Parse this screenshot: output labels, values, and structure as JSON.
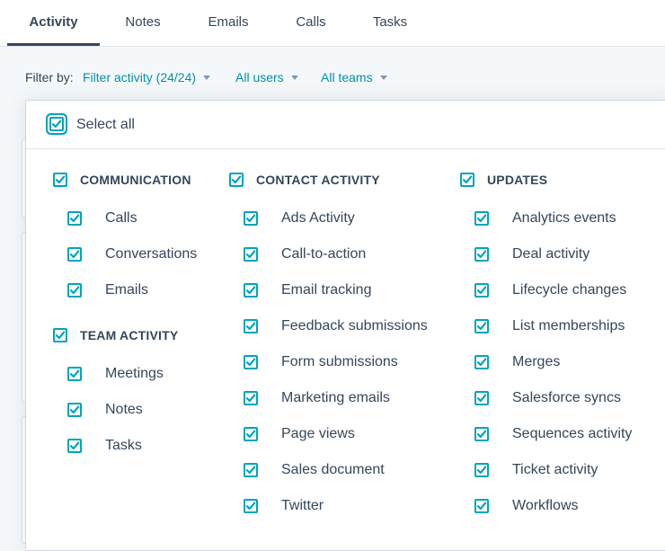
{
  "tabs": [
    {
      "label": "Activity",
      "active": true
    },
    {
      "label": "Notes",
      "active": false
    },
    {
      "label": "Emails",
      "active": false
    },
    {
      "label": "Calls",
      "active": false
    },
    {
      "label": "Tasks",
      "active": false
    }
  ],
  "filter": {
    "label": "Filter by:",
    "activity": "Filter activity (24/24)",
    "users": "All users",
    "teams": "All teams"
  },
  "dropdown": {
    "select_all": {
      "label": "Select all",
      "checked": true
    },
    "columns": [
      {
        "groups": [
          {
            "label": "COMMUNICATION",
            "checked": true,
            "items": [
              {
                "label": "Calls",
                "checked": true
              },
              {
                "label": "Conversations",
                "checked": true
              },
              {
                "label": "Emails",
                "checked": true
              }
            ]
          },
          {
            "label": "TEAM ACTIVITY",
            "checked": true,
            "items": [
              {
                "label": "Meetings",
                "checked": true
              },
              {
                "label": "Notes",
                "checked": true
              },
              {
                "label": "Tasks",
                "checked": true
              }
            ]
          }
        ]
      },
      {
        "groups": [
          {
            "label": "CONTACT ACTIVITY",
            "checked": true,
            "items": [
              {
                "label": "Ads Activity",
                "checked": true
              },
              {
                "label": "Call-to-action",
                "checked": true
              },
              {
                "label": "Email tracking",
                "checked": true
              },
              {
                "label": "Feedback submissions",
                "checked": true
              },
              {
                "label": "Form submissions",
                "checked": true
              },
              {
                "label": "Marketing emails",
                "checked": true
              },
              {
                "label": "Page views",
                "checked": true
              },
              {
                "label": "Sales document",
                "checked": true
              },
              {
                "label": "Twitter",
                "checked": true
              }
            ]
          }
        ]
      },
      {
        "groups": [
          {
            "label": "UPDATES",
            "checked": true,
            "items": [
              {
                "label": "Analytics events",
                "checked": true
              },
              {
                "label": "Deal activity",
                "checked": true
              },
              {
                "label": "Lifecycle changes",
                "checked": true
              },
              {
                "label": "List memberships",
                "checked": true
              },
              {
                "label": "Merges",
                "checked": true
              },
              {
                "label": "Salesforce syncs",
                "checked": true
              },
              {
                "label": "Sequences activity",
                "checked": true
              },
              {
                "label": "Ticket activity",
                "checked": true
              },
              {
                "label": "Workflows",
                "checked": true
              }
            ]
          }
        ]
      }
    ]
  },
  "colors": {
    "accent": "#00a4bd",
    "link": "#0091ae",
    "text": "#33475b",
    "border": "#dfe3eb"
  }
}
